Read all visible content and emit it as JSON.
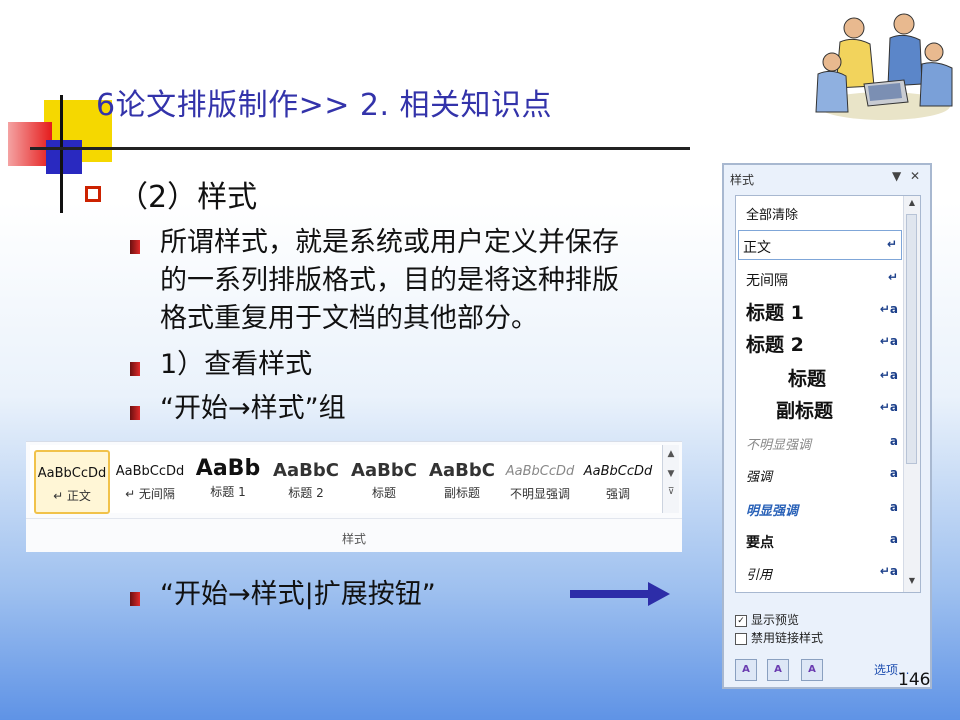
{
  "slide": {
    "title": "6论文排版制作>> 2. 相关知识点",
    "heading": "（2）样式",
    "bullets": [
      "所谓样式，就是系统或用户定义并保存",
      "的一系列排版格式，目的是将这种排版",
      "格式重复用于文档的其他部分。"
    ],
    "bullet2": "1）查看样式",
    "bullet3": "“开始→样式”组",
    "bullet4": "“开始→样式|扩展按钮”",
    "page_number": "146"
  },
  "ribbon": {
    "group_label": "样式",
    "items": [
      {
        "sample": "AaBbCcDd",
        "label": "↵ 正文"
      },
      {
        "sample": "AaBbCcDd",
        "label": "↵ 无间隔"
      },
      {
        "sample": "AaBb",
        "label": "标题 1"
      },
      {
        "sample": "AaBbC",
        "label": "标题 2"
      },
      {
        "sample": "AaBbC",
        "label": "标题"
      },
      {
        "sample": "AaBbC",
        "label": "副标题"
      },
      {
        "sample": "AaBbCcDd",
        "label": "不明显强调"
      },
      {
        "sample": "AaBbCcDd",
        "label": "强调"
      }
    ]
  },
  "styles_pane": {
    "title": "样式",
    "items": [
      {
        "name": "全部清除",
        "mark": ""
      },
      {
        "name": "正文",
        "mark": "↵"
      },
      {
        "name": "无间隔",
        "mark": "↵"
      },
      {
        "name": "标题 1",
        "mark": "↵a"
      },
      {
        "name": "标题 2",
        "mark": "↵a"
      },
      {
        "name": "标题",
        "mark": "↵a"
      },
      {
        "name": "副标题",
        "mark": "↵a"
      },
      {
        "name": "不明显强调",
        "mark": "a"
      },
      {
        "name": "强调",
        "mark": "a"
      },
      {
        "name": "明显强调",
        "mark": "a"
      },
      {
        "name": "要点",
        "mark": "a"
      },
      {
        "name": "引用",
        "mark": "↵a"
      }
    ],
    "show_preview_label": "显示预览",
    "show_preview_checked": true,
    "disable_linked_label": "禁用链接样式",
    "disable_linked_checked": false,
    "options_label": "选项..."
  }
}
